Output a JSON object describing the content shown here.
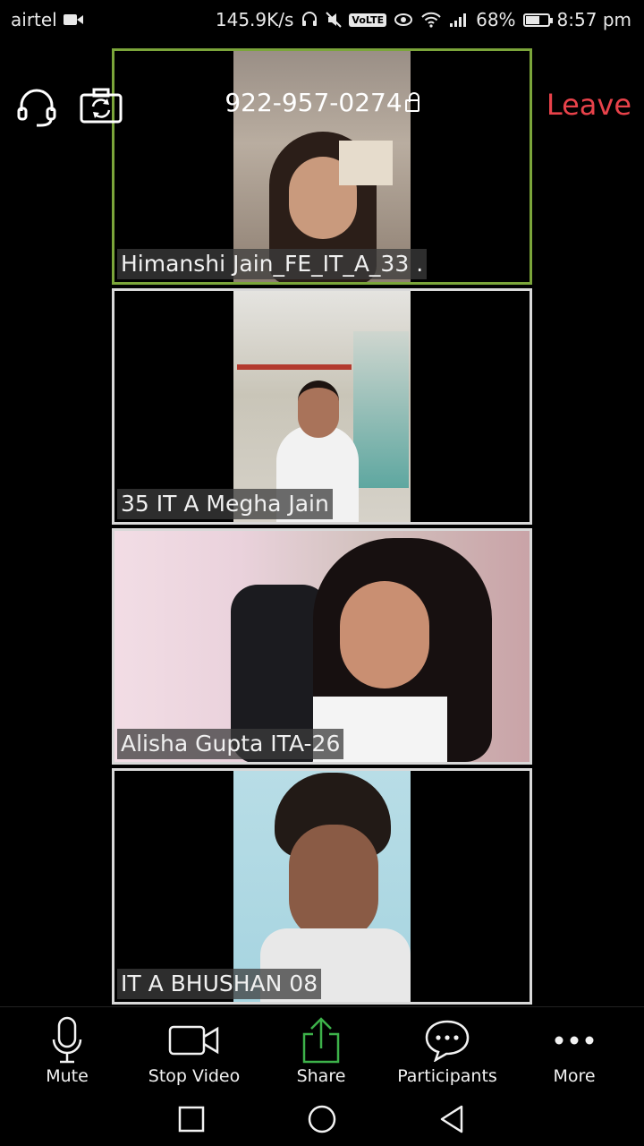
{
  "status_bar": {
    "carrier": "airtel",
    "net_speed": "145.9K/s",
    "volte": "VoLTE",
    "battery": "68%",
    "battery_level": 0.68,
    "time": "8:57 pm"
  },
  "meeting": {
    "id": "922-957-0274",
    "leave_label": "Leave"
  },
  "participants": [
    {
      "name": "Himanshi Jain_FE_IT_A_33 .",
      "active_speaker": true
    },
    {
      "name": "35 IT A Megha Jain",
      "active_speaker": false
    },
    {
      "name": "Alisha Gupta ITA-26",
      "active_speaker": false
    },
    {
      "name": "IT A BHUSHAN 08",
      "active_speaker": false
    }
  ],
  "toolbar": {
    "mute": "Mute",
    "stop_video": "Stop Video",
    "share": "Share",
    "participants": "Participants",
    "more": "More"
  },
  "colors": {
    "active_border": "#7ba53a",
    "tile_border": "#d9d9d9",
    "leave": "#e8424a",
    "share_icon": "#3db24a"
  }
}
